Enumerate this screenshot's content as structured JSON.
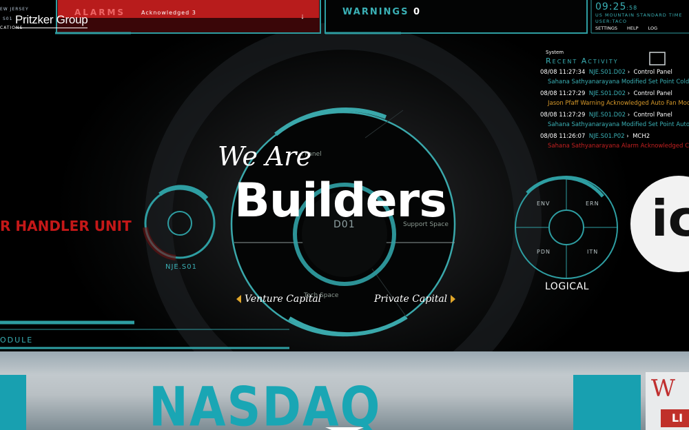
{
  "brand": {
    "name": "Pritzker Group"
  },
  "hud": {
    "alarms_label": "ALARMS",
    "acknowledged": "Acknowledged 3",
    "warnings": "WARNINGS",
    "warnings_count": "0",
    "clock": "09:25",
    "clock_seconds": ":58",
    "timezone": "US MOUNTAIN STANDARD TIME",
    "user": "USER:TACO",
    "menu": [
      "SETTINGS",
      "HELP",
      "LOG"
    ],
    "location_top": "EW JERSEY",
    "location_code": "S01",
    "locations_label": "CATIONS",
    "recent_activity_label": "System",
    "recent_activity_title": "Recent Activity",
    "activity": [
      {
        "time": "08/08 11:27:34",
        "code": "NJE.S01.D02",
        "panel": "Control Panel",
        "detail": "Sahana Sathyanarayana Modified Set Point Cold Aisle Te",
        "detail_color": "#3ab0b5"
      },
      {
        "time": "08/08 11:27:29",
        "code": "NJE.S01.D02",
        "panel": "Control Panel",
        "detail": "Jason Pfaff Warning Acknowledged Auto Fan Mode",
        "detail_color": "#d89a2a"
      },
      {
        "time": "08/08 11:27:29",
        "code": "NJE.S01.D02",
        "panel": "Control Panel",
        "detail": "Sahana Sathyanarayana Modified Set Point Auto Fan Mo",
        "detail_color": "#3ab0b5"
      },
      {
        "time": "08/08 11:26:07",
        "code": "NJE.S01.P02",
        "panel": "MCH2",
        "detail": "Sahana Sathyanarayana Alarm Acknowledged CW Sup T",
        "detail_color": "#c42020"
      }
    ],
    "handler_unit": "R HANDLER UNIT",
    "nje_label": "NJE.S01",
    "center_label": "D01",
    "panel_label": "l Panel",
    "support_space": "Support Space",
    "tech_space": "Tech Space",
    "quad": [
      "ENV",
      "ERN",
      "PDN",
      "ITN"
    ],
    "logical_label": "LOGICAL",
    "module_label": "ODULE"
  },
  "hero": {
    "subtitle": "We Are",
    "title": "Builders",
    "left_link": "Venture Capital",
    "right_link": "Private Capital"
  },
  "band": {
    "nasdaq": "NASDAQ",
    "corner_badge_top": "W",
    "corner_badge_bottom": "LI"
  }
}
